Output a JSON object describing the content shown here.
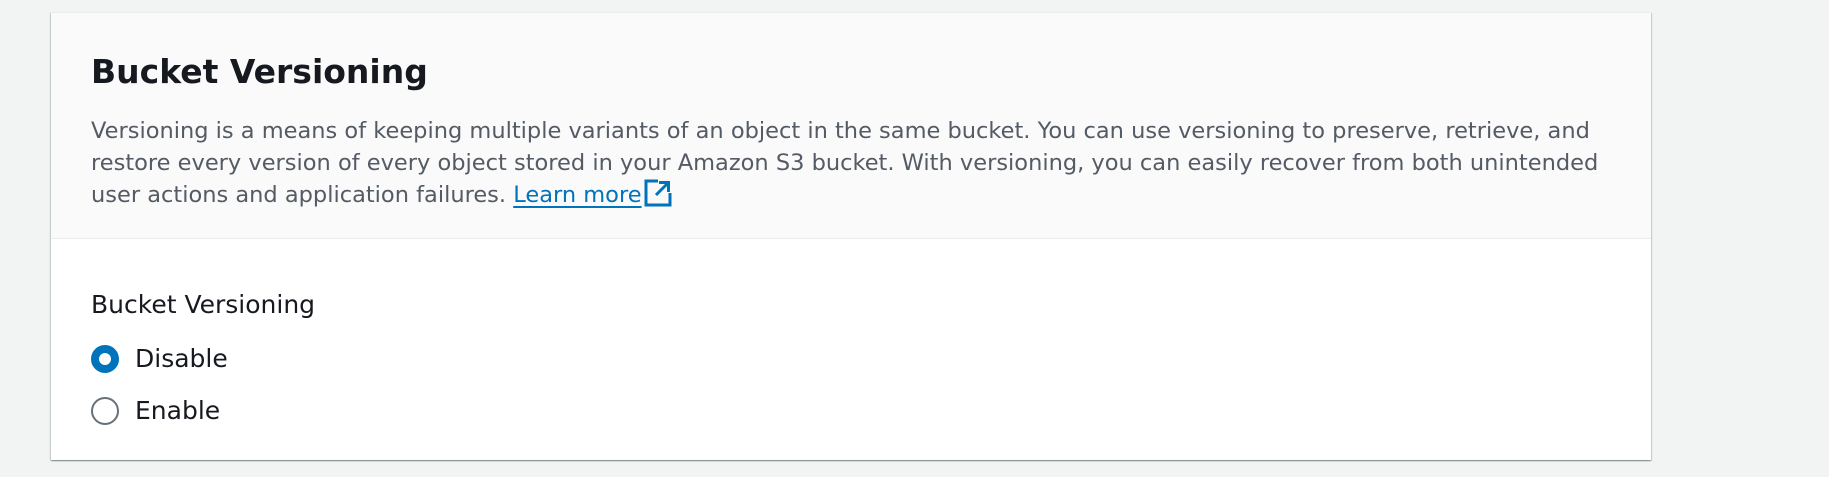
{
  "panel": {
    "title": "Bucket Versioning",
    "description": "Versioning is a means of keeping multiple variants of an object in the same bucket. You can use versioning to preserve, retrieve, and restore every version of every object stored in your Amazon S3 bucket. With versioning, you can easily recover from both unintended user actions and application failures.",
    "learn_more_label": "Learn more",
    "learn_more_icon": "external-link-icon"
  },
  "versioning": {
    "label": "Bucket Versioning",
    "options": [
      {
        "label": "Disable",
        "checked": true
      },
      {
        "label": "Enable",
        "checked": false
      }
    ],
    "selected": "Disable"
  },
  "colors": {
    "page_background": "#f2f3f3",
    "header_background": "#fafafa",
    "link": "#0073bb",
    "radio_selected": "#0073bb",
    "text_primary": "#16191f",
    "text_secondary": "#545b64"
  }
}
